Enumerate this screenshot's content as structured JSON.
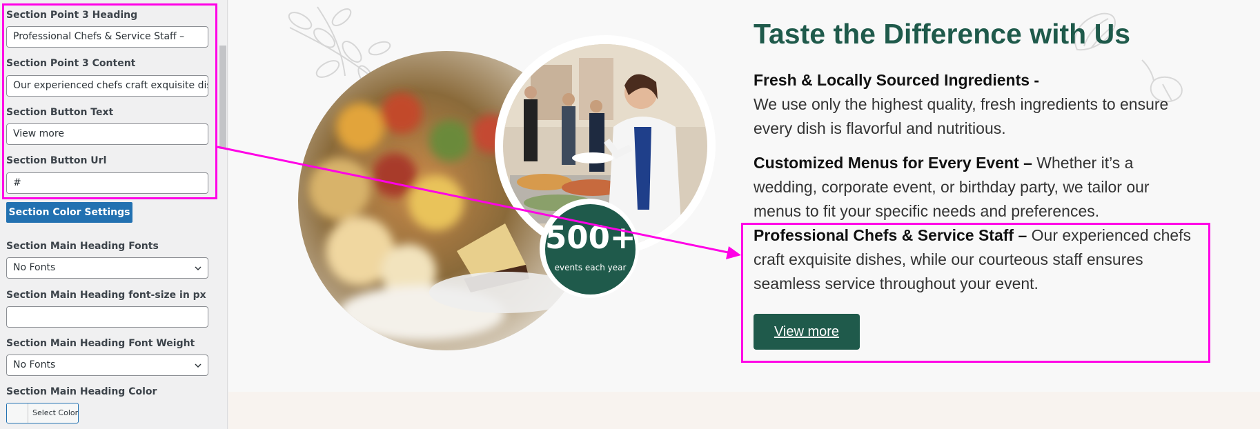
{
  "sidebar": {
    "point3_heading_label": "Section Point 3 Heading",
    "point3_heading_value": "Professional Chefs & Service Staff –",
    "point3_content_label": "Section Point 3 Content",
    "point3_content_value": "Our experienced chefs craft exquisite dishe",
    "button_text_label": "Section Button Text",
    "button_text_value": "View more",
    "button_url_label": "Section Button Url",
    "button_url_value": "#",
    "color_settings_button": "Section Color Settings",
    "main_heading_fonts_label": "Section Main Heading Fonts",
    "main_heading_fonts_value": "No Fonts",
    "main_heading_fontsize_label": "Section Main Heading font-size in px",
    "main_heading_fontsize_value": "",
    "main_heading_weight_label": "Section Main Heading Font Weight",
    "main_heading_weight_value": "No Fonts",
    "main_heading_color_label": "Section Main Heading Color",
    "select_color_button": "Select Color"
  },
  "preview": {
    "heading": "Taste the Difference with Us",
    "points": [
      {
        "title": "Fresh & Locally Sourced Ingredients -",
        "text": "We use only the highest quality, fresh ingredients to ensure every dish is flavorful and nutritious."
      },
      {
        "title": "Customized Menus for Every Event –",
        "text": " Whether it’s a wedding, corporate event, or birthday party, we tailor our menus to fit your specific needs and preferences."
      },
      {
        "title": "Professional Chefs & Service Staff –",
        "text": " Our experienced chefs craft exquisite dishes, while our courteous staff ensures seamless service throughout your event."
      }
    ],
    "stat_number": "500+",
    "stat_label": "events each year",
    "button_label": "View more"
  },
  "colors": {
    "brand_green": "#1f5a4b",
    "wp_blue": "#2271b1",
    "annotation_magenta": "#ff00e6"
  },
  "icons": [
    "leaf-decoration-icon",
    "garlic-icon",
    "chevron-down-icon",
    "arrow-icon"
  ]
}
